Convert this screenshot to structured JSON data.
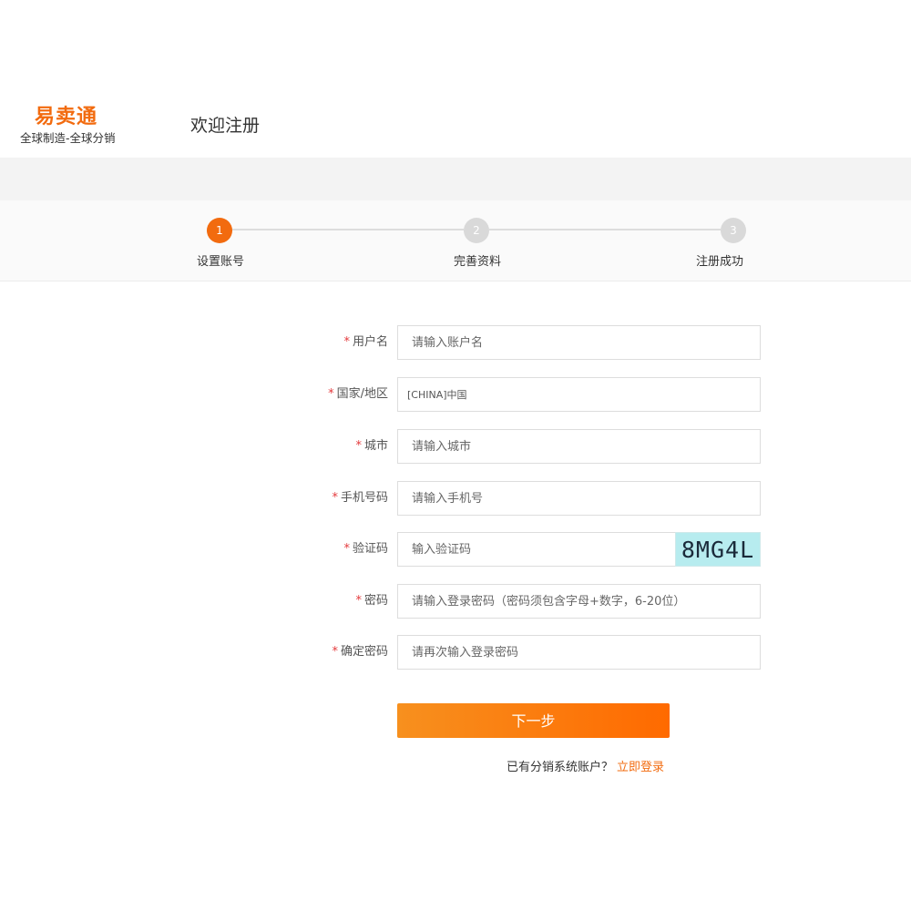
{
  "header": {
    "logo_main": "易卖通",
    "logo_sub": "全球制造-全球分销",
    "page_title": "欢迎注册"
  },
  "steps": [
    {
      "number": "1",
      "label": "设置账号",
      "active": true
    },
    {
      "number": "2",
      "label": "完善资料",
      "active": false
    },
    {
      "number": "3",
      "label": "注册成功",
      "active": false
    }
  ],
  "form": {
    "required_mark": "*",
    "username": {
      "label": "用户名",
      "placeholder": "请输入账户名"
    },
    "country": {
      "label": "国家/地区",
      "value": "[CHINA]中国"
    },
    "city": {
      "label": "城市",
      "placeholder": "请输入城市"
    },
    "phone": {
      "label": "手机号码",
      "placeholder": "请输入手机号"
    },
    "captcha": {
      "label": "验证码",
      "placeholder": "输入验证码",
      "image_text": "8MG4L"
    },
    "password": {
      "label": "密码",
      "placeholder": "请输入登录密码（密码须包含字母+数字，6-20位）"
    },
    "confirm_password": {
      "label": "确定密码",
      "placeholder": "请再次输入登录密码"
    },
    "next_button": "下一步"
  },
  "login_prompt": {
    "text": "已有分销系统账户？",
    "link": "立即登录"
  },
  "colors": {
    "brand": "#f26b0f",
    "button_gradient_start": "#f7901e",
    "button_gradient_end": "#ff6a00",
    "required": "#e4393c"
  }
}
